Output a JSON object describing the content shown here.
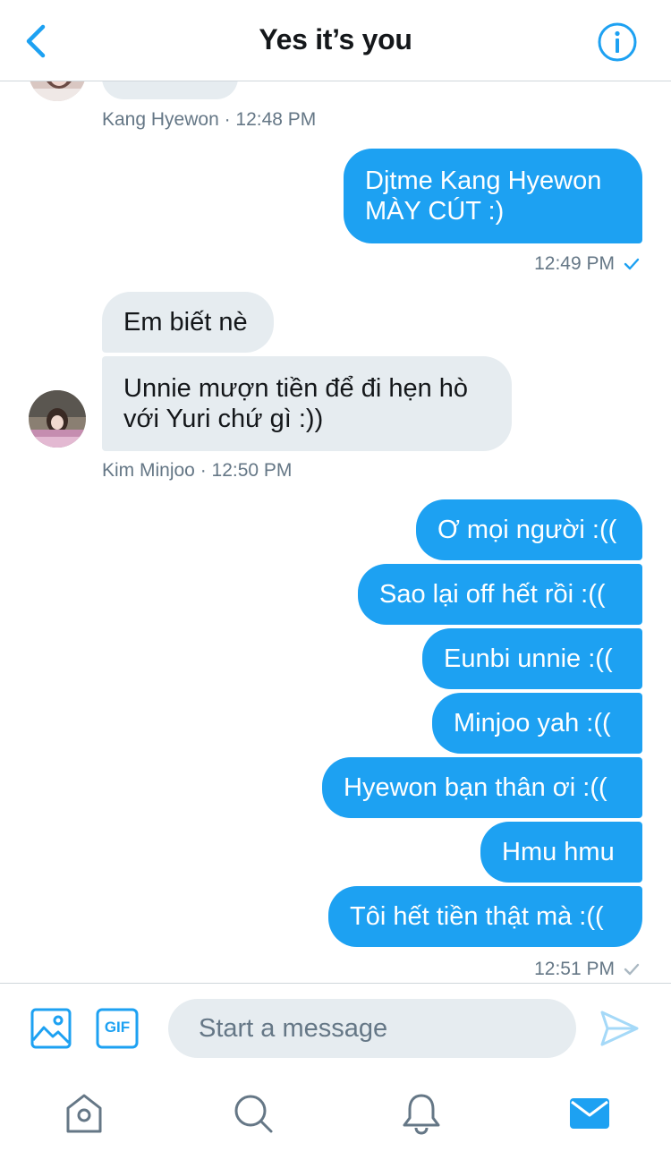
{
  "header": {
    "title": "Yes it’s you",
    "back_icon": "chevron-left-icon",
    "info_icon": "info-icon"
  },
  "messages": {
    "group1": {
      "meta": "Kang Hyewon · 12:48 PM",
      "partial_bubble_text": "…"
    },
    "group2": {
      "text": "Djtme Kang Hyewon\nMÀY CÚT :)",
      "time": "12:49 PM"
    },
    "group3": {
      "bubbles": [
        "Em biết nè",
        "Unnie mượn tiền để đi hẹn hò\nvới Yuri chứ gì :))"
      ],
      "meta": "Kim Minjoo · 12:50 PM"
    },
    "group4": {
      "bubbles": [
        "Ơ mọi người :((",
        "Sao lại off hết rồi :((",
        "Eunbi unnie :((",
        "Minjoo yah :((",
        "Hyewon bạn thân ơi :((",
        "Hmu hmu",
        "Tôi hết tiền thật mà :(("
      ],
      "time": "12:51 PM"
    }
  },
  "composer": {
    "placeholder": "Start a message",
    "gif_label": "GIF"
  },
  "tabs": [
    {
      "name": "tab-home",
      "icon": "home-icon"
    },
    {
      "name": "tab-search",
      "icon": "search-icon"
    },
    {
      "name": "tab-notifications",
      "icon": "bell-icon"
    },
    {
      "name": "tab-messages",
      "icon": "mail-icon",
      "active": true
    }
  ],
  "colors": {
    "accent": "#1da1f2",
    "incoming_bubble": "#e6ecf0",
    "meta_text": "#657786",
    "title_text": "#14171a"
  }
}
